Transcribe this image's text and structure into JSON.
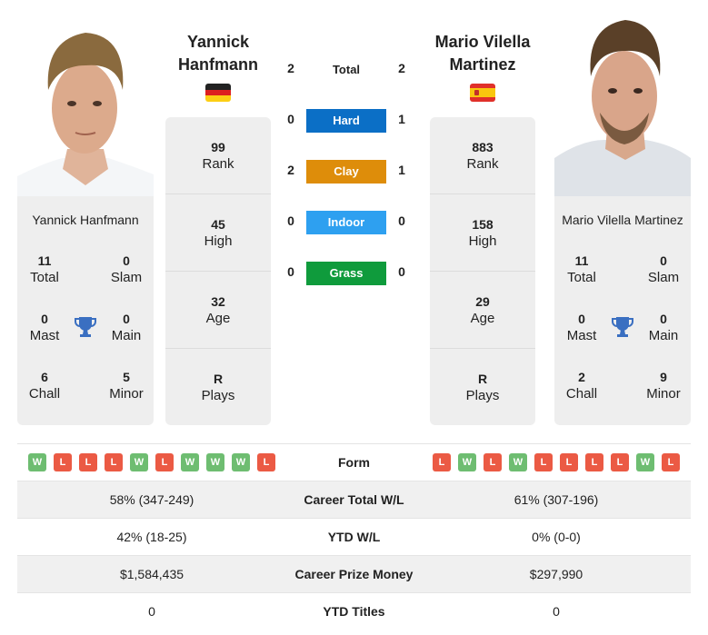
{
  "colors": {
    "hard": "#0b6fc6",
    "clay": "#de8d0a",
    "indoor": "#2ea0f0",
    "grass": "#0f9b3c",
    "win": "#6ebd71",
    "loss": "#eb5a44",
    "trophy": "#3a6fc1"
  },
  "player1": {
    "name_line1": "Yannick",
    "name_line2": "Hanfmann",
    "full_name": "Yannick Hanfmann",
    "country": "Germany",
    "flag_icon": "flag-germany",
    "rank": "99",
    "rank_label": "Rank",
    "high": "45",
    "high_label": "High",
    "age": "32",
    "age_label": "Age",
    "plays": "R",
    "plays_label": "Plays",
    "titles": {
      "total": "11",
      "total_label": "Total",
      "slam": "0",
      "slam_label": "Slam",
      "mast": "0",
      "mast_label": "Mast",
      "main": "0",
      "main_label": "Main",
      "chall": "6",
      "chall_label": "Chall",
      "minor": "5",
      "minor_label": "Minor"
    },
    "form": [
      "W",
      "L",
      "L",
      "L",
      "W",
      "L",
      "W",
      "W",
      "W",
      "L"
    ]
  },
  "player2": {
    "name_line1": "Mario Vilella",
    "name_line2": "Martinez",
    "full_name": "Mario Vilella Martinez",
    "country": "Spain",
    "flag_icon": "flag-spain",
    "rank": "883",
    "rank_label": "Rank",
    "high": "158",
    "high_label": "High",
    "age": "29",
    "age_label": "Age",
    "plays": "R",
    "plays_label": "Plays",
    "titles": {
      "total": "11",
      "total_label": "Total",
      "slam": "0",
      "slam_label": "Slam",
      "mast": "0",
      "mast_label": "Mast",
      "main": "0",
      "main_label": "Main",
      "chall": "2",
      "chall_label": "Chall",
      "minor": "9",
      "minor_label": "Minor"
    },
    "form": [
      "L",
      "W",
      "L",
      "W",
      "L",
      "L",
      "L",
      "L",
      "W",
      "L"
    ]
  },
  "h2h": {
    "total_label": "Total",
    "total": {
      "p1": "2",
      "p2": "2"
    },
    "surfaces": [
      {
        "label": "Hard",
        "p1": "0",
        "p2": "1"
      },
      {
        "label": "Clay",
        "p1": "2",
        "p2": "1"
      },
      {
        "label": "Indoor",
        "p1": "0",
        "p2": "0"
      },
      {
        "label": "Grass",
        "p1": "0",
        "p2": "0"
      }
    ]
  },
  "table": {
    "form_label": "Form",
    "rows": [
      {
        "label": "Career Total W/L",
        "p1": "58% (347-249)",
        "p2": "61% (307-196)"
      },
      {
        "label": "YTD W/L",
        "p1": "42% (18-25)",
        "p2": "0% (0-0)"
      },
      {
        "label": "Career Prize Money",
        "p1": "$1,584,435",
        "p2": "$297,990"
      },
      {
        "label": "YTD Titles",
        "p1": "0",
        "p2": "0"
      }
    ]
  }
}
